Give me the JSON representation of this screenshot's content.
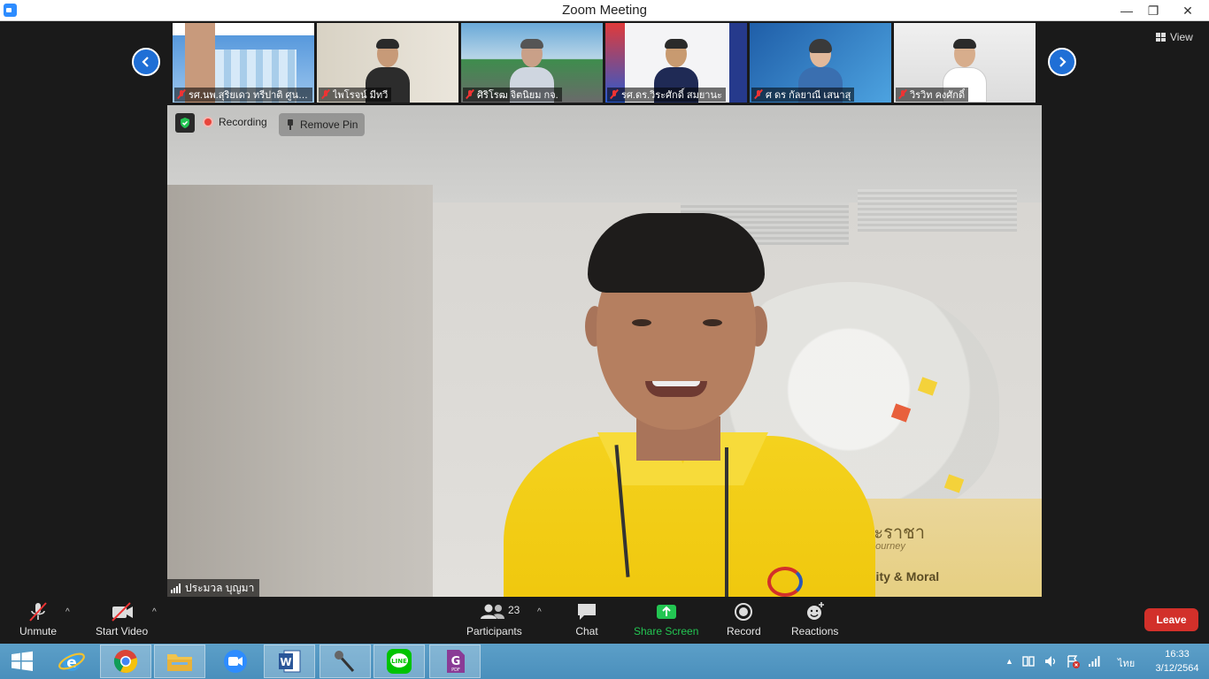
{
  "window": {
    "title": "Zoom Meeting",
    "minimize": "—",
    "maximize": "❐",
    "close": "✕"
  },
  "view": {
    "label": "View"
  },
  "thumbnails": [
    {
      "name": "รศ.นพ.สุริยเดว ทรีปาติ ศูนย์คุณธ...",
      "muted": true,
      "bg": "#2b6fb5"
    },
    {
      "name": "ไพโรจน์ มีทวี",
      "muted": true,
      "bg": "#d9d4c8"
    },
    {
      "name": "ศิริโรฒ จิตนิยม กจ.",
      "muted": true,
      "bg": "#5a8fb0"
    },
    {
      "name": "รศ.ดร.วิระศักดิ์ สมยานะ",
      "muted": true,
      "bg": "#f4f4f6"
    },
    {
      "name": "ศ ดร กัลยาณี เสนาสุ",
      "muted": true,
      "bg": "#3d86c6"
    },
    {
      "name": "วิรวิท คงศักดิ์",
      "muted": true,
      "bg": "#e9e9e9"
    }
  ],
  "main_video": {
    "recording_label": "Recording",
    "remove_pin_label": "Remove Pin",
    "speaker_name": "ประมวล บุญมา",
    "banner_line1": "รอยพระราชา",
    "banner_line2": "The King's Journey",
    "banner_line3": "inability & Moral"
  },
  "toolbar": {
    "unmute": "Unmute",
    "start_video": "Start Video",
    "participants": "Participants",
    "participant_count": "23",
    "chat": "Chat",
    "share_screen": "Share Screen",
    "record": "Record",
    "reactions": "Reactions",
    "leave": "Leave",
    "caret": "^"
  },
  "taskbar": {
    "time": "16:33",
    "date": "3/12/2564",
    "language": "ไทย"
  },
  "colors": {
    "accent": "#2d8cff",
    "share_green": "#23c552",
    "leave_red": "#d2302a",
    "taskbar": "#4a8fbc"
  }
}
